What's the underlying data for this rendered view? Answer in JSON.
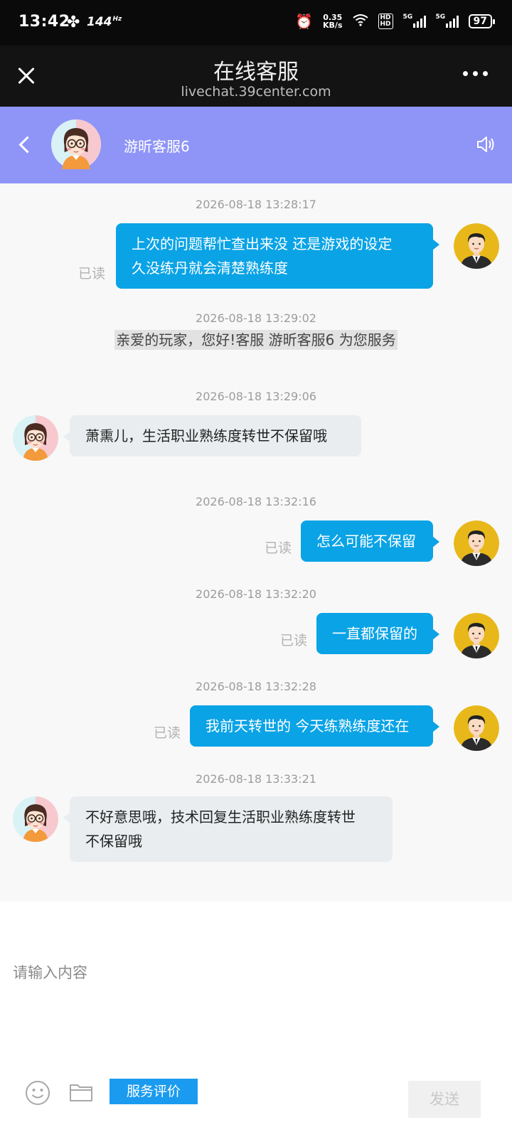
{
  "status_bar": {
    "time": "13:42",
    "refresh_rate": "144",
    "refresh_unit": "Hz",
    "net_speed_value": "0.35",
    "net_speed_unit": "KB/s",
    "hd_label": "HD",
    "signal_1": "5G",
    "signal_2": "5G",
    "battery": "97"
  },
  "browser": {
    "title": "在线客服",
    "url": "livechat.39center.com"
  },
  "chat_header": {
    "agent_name": "游昕客服6",
    "accent_color": "#8f95f7"
  },
  "messages": [
    {
      "timestamp": "2026-08-18 13:28:17",
      "direction": "out",
      "lines": [
        "上次的问题帮忙查出来没 还是游戏的设定",
        "久没练丹就会清楚熟练度"
      ],
      "read_label": "已读"
    },
    {
      "timestamp": "2026-08-18 13:29:02",
      "system_text": "亲爱的玩家，您好!客服 游昕客服6 为您服务"
    },
    {
      "timestamp": "2026-08-18 13:29:06",
      "direction": "in",
      "lines": [
        "萧熏儿，生活职业熟练度转世不保留哦"
      ]
    },
    {
      "timestamp": "2026-08-18 13:32:16",
      "direction": "out",
      "lines": [
        "怎么可能不保留"
      ],
      "read_label": "已读"
    },
    {
      "timestamp": "2026-08-18 13:32:20",
      "direction": "out",
      "lines": [
        "一直都保留的"
      ],
      "read_label": "已读"
    },
    {
      "timestamp": "2026-08-18 13:32:28",
      "direction": "out",
      "lines": [
        "我前天转世的 今天练熟练度还在"
      ],
      "read_label": "已读"
    },
    {
      "timestamp": "2026-08-18 13:33:21",
      "direction": "in",
      "lines": [
        "不好意思哦，技术回复生活职业熟练度转世",
        "不保留哦"
      ]
    }
  ],
  "input": {
    "placeholder": "请输入内容",
    "rate_button": "服务评价",
    "send_button": "发送"
  },
  "colors": {
    "outgoing_bubble": "#0aa3e6",
    "incoming_bubble": "#e9edef",
    "rate_button": "#1a9bf0"
  },
  "icons": [
    "close-icon",
    "more-icon",
    "back-icon",
    "speaker-icon",
    "emoji-icon",
    "folder-icon",
    "agent-avatar",
    "user-avatar"
  ]
}
